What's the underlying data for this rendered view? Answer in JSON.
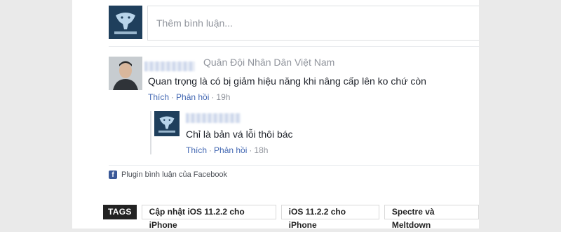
{
  "composer": {
    "placeholder": "Thêm bình luận..."
  },
  "comments": [
    {
      "affiliation": "Quân Đội Nhân Dân Việt Nam",
      "text": "Quan trọng là có bị giảm hiệu năng khi nâng cấp lên ko chứ còn",
      "like_label": "Thích",
      "reply_label": "Phản hồi",
      "separator": "·",
      "time": "19h",
      "replies": [
        {
          "text": "Chỉ là bản vá lỗi thôi bác",
          "like_label": "Thích",
          "reply_label": "Phản hồi",
          "separator": "·",
          "time": "18h"
        }
      ]
    }
  ],
  "plugin": {
    "icon": "facebook-icon",
    "label": "Plugin bình luận của Facebook"
  },
  "tags": {
    "label": "TAGS",
    "items": [
      "Cập nhật iOS 11.2.2 cho iPhone",
      "iOS 11.2.2 cho iPhone",
      "Spectre và Meltdown"
    ]
  },
  "colors": {
    "link": "#4267b2",
    "muted": "#90949c",
    "text": "#1d2129",
    "background": "#eaeaea",
    "avatar": "#1f3f5c"
  }
}
